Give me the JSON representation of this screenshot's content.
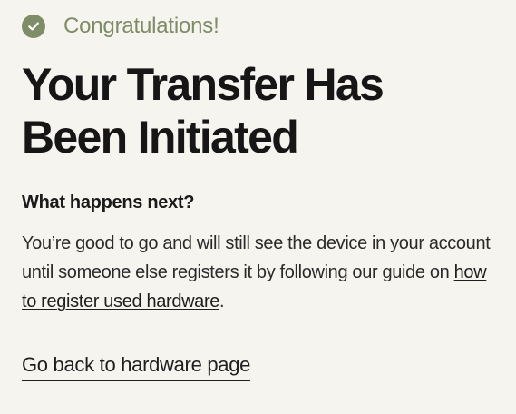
{
  "colors": {
    "background": "#f6f4ef",
    "accent_green": "#7e8c67",
    "text_dark": "#161616"
  },
  "confirmation": {
    "icon": "check-circle-icon",
    "congrats_label": "Congratulations!"
  },
  "headline": {
    "line1": "Your Transfer Has",
    "line2": "Been Initiated"
  },
  "next_steps": {
    "heading": "What happens next?",
    "body_prefix": "You’re good to go and will still see the device in your account until someone else registers it by following our guide on ",
    "link_text": "how to register used hardware",
    "body_suffix": "."
  },
  "footer": {
    "back_link_label": "Go back to hardware page"
  }
}
